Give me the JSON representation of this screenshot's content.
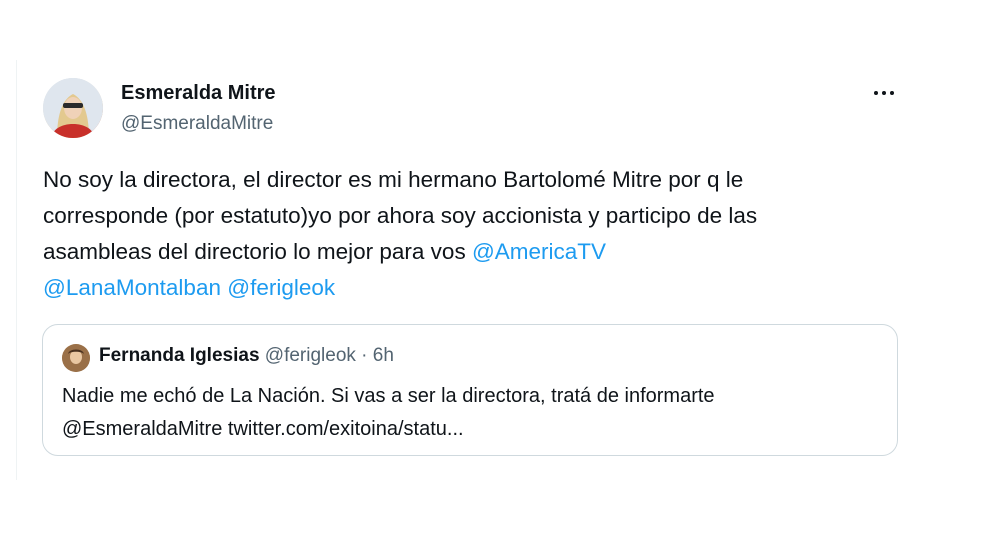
{
  "tweet": {
    "author": {
      "name": "Esmeralda Mitre",
      "handle": "@EsmeraldaMitre"
    },
    "body": {
      "line1": "No soy la directora, el director es mi hermano Bartolomé Mitre por q le",
      "line2": "corresponde (por estatuto)yo por ahora soy accionista y participo de las",
      "line3_text": "asambleas del directorio lo mejor para vos ",
      "line3_mention": "@AmericaTV",
      "line4_mention1": "@LanaMontalban",
      "line4_mention2": "@ferigleok"
    },
    "more_icon": "more-horizontal-icon"
  },
  "quoted_tweet": {
    "name": "Fernanda Iglesias",
    "handle": "@ferigleok",
    "separator": " · ",
    "time": "6h",
    "line1": "Nadie me echó de La Nación. Si vas a ser la directora, tratá de informarte",
    "line2": "@EsmeraldaMitre twitter.com/exitoina/statu..."
  },
  "colors": {
    "link": "#1d9bf0",
    "text": "#0f1419",
    "secondary": "#536471",
    "border": "#cfd9de"
  }
}
